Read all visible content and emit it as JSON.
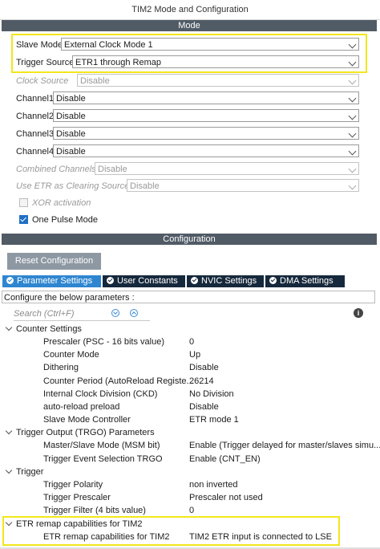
{
  "window_title": "TIM2 Mode and Configuration",
  "mode_section": {
    "header": "Mode",
    "fields": [
      {
        "label": "Slave Mode",
        "value": "External Clock Mode 1",
        "disabled": false
      },
      {
        "label": "Trigger Source",
        "value": "ETR1 through Remap",
        "disabled": false
      },
      {
        "label": "Clock Source",
        "value": "Disable",
        "disabled": true
      },
      {
        "label": "Channel1",
        "value": "Disable",
        "disabled": false
      },
      {
        "label": "Channel2",
        "value": "Disable",
        "disabled": false
      },
      {
        "label": "Channel3",
        "value": "Disable",
        "disabled": false
      },
      {
        "label": "Channel4",
        "value": "Disable",
        "disabled": false
      },
      {
        "label": "Combined Channels",
        "value": "Disable",
        "disabled": true
      },
      {
        "label": "Use ETR as Clearing Source",
        "value": "Disable",
        "disabled": true
      }
    ],
    "checkboxes": [
      {
        "label": "XOR activation",
        "checked": false,
        "disabled": true
      },
      {
        "label": "One Pulse Mode",
        "checked": true,
        "disabled": false
      }
    ]
  },
  "config_section": {
    "header": "Configuration",
    "reset_button": "Reset Configuration",
    "tabs": [
      "Parameter Settings",
      "User Constants",
      "NVIC Settings",
      "DMA Settings"
    ],
    "active_tab": "Parameter Settings",
    "instruction": "Configure the below parameters :",
    "search_placeholder": "Search (Ctrl+F)",
    "info_icon": "i"
  },
  "parameter_groups": [
    {
      "name": "Counter Settings",
      "params": [
        {
          "name": "Prescaler (PSC - 16 bits value)",
          "value": "0"
        },
        {
          "name": "Counter Mode",
          "value": "Up"
        },
        {
          "name": "Dithering",
          "value": "Disable"
        },
        {
          "name": "Counter Period (AutoReload Registe...",
          "value": "26214"
        },
        {
          "name": "Internal Clock Division (CKD)",
          "value": "No Division"
        },
        {
          "name": "auto-reload preload",
          "value": "Disable"
        },
        {
          "name": "Slave Mode Controller",
          "value": "ETR mode 1"
        }
      ]
    },
    {
      "name": "Trigger Output (TRGO) Parameters",
      "params": [
        {
          "name": "Master/Slave Mode (MSM bit)",
          "value": "Enable (Trigger delayed for master/slaves simu..."
        },
        {
          "name": "Trigger Event Selection TRGO",
          "value": "Enable (CNT_EN)"
        }
      ]
    },
    {
      "name": "Trigger",
      "params": [
        {
          "name": "Trigger Polarity",
          "value": "non inverted"
        },
        {
          "name": "Trigger Prescaler",
          "value": "Prescaler not used"
        },
        {
          "name": "Trigger Filter (4 bits value)",
          "value": "0"
        }
      ]
    },
    {
      "name": "ETR remap capabilities for TIM2",
      "params": [
        {
          "name": "ETR remap capabilities for TIM2",
          "value": "TIM2 ETR input is connected to LSE"
        }
      ]
    }
  ],
  "colors": {
    "section_bar": "#515b66",
    "tab_active": "#2f86d0",
    "tab_inactive": "#16283c",
    "highlight": "#f2e61d"
  }
}
